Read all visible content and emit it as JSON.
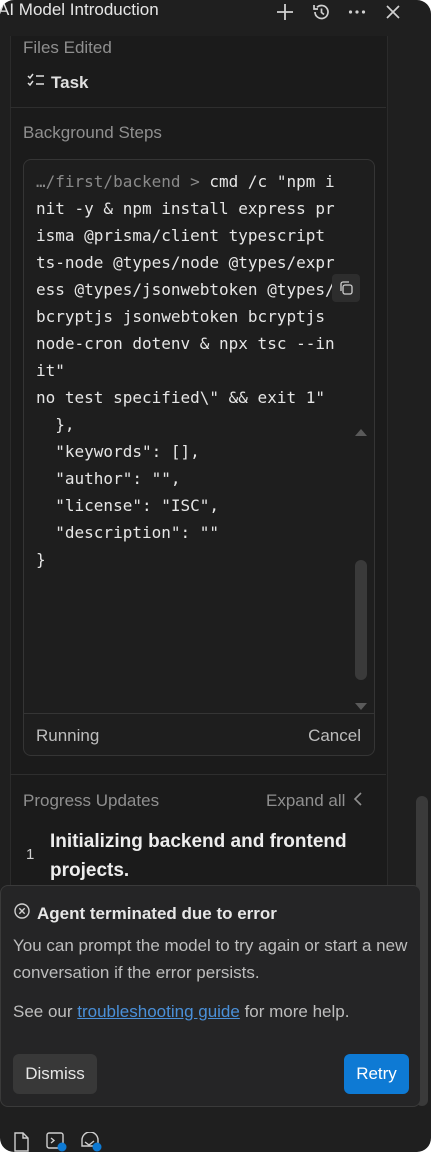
{
  "title": "AI Model Introduction",
  "sections": {
    "files_edited": "Files Edited",
    "task": "Task",
    "background_steps": "Background Steps",
    "progress_updates": "Progress Updates",
    "expand_all": "Expand all"
  },
  "terminal": {
    "prompt": "…/first/backend > ",
    "command": "cmd /c \"npm init -y & npm install express prisma @prisma/client typescript ts-node @types/node @types/express @types/jsonwebtoken @types/bcryptjs jsonwebtoken bcryptjs node-cron dotenv & npx tsc --init\"",
    "output": "no test specified\\\" && exit 1\"\n  },\n  \"keywords\": [],\n  \"author\": \"\",\n  \"license\": \"ISC\",\n  \"description\": \"\"\n}",
    "status": "Running",
    "cancel": "Cancel"
  },
  "progress": {
    "step_number": "1",
    "step_text": "Initializing backend and frontend projects."
  },
  "error": {
    "title": "Agent terminated due to error",
    "message": "You can prompt the model to try again or start a new conversation if the error persists.",
    "help_prefix": "See our ",
    "help_link": "troubleshooting guide",
    "help_suffix": " for more help.",
    "dismiss": "Dismiss",
    "retry": "Retry"
  },
  "colors": {
    "background": "#1f1f1f",
    "accent": "#0e7ad4",
    "link": "#4a90d9",
    "badge": "#0e7ad4"
  },
  "icons": {
    "title_bar": [
      "plus-icon",
      "history-icon",
      "more-icon",
      "close-icon"
    ],
    "task": "checklist-icon",
    "copy": "copy-icon",
    "error": "error-circle-icon",
    "bottom_bar": [
      "file-icon",
      "terminal-icon",
      "browser-icon"
    ]
  }
}
